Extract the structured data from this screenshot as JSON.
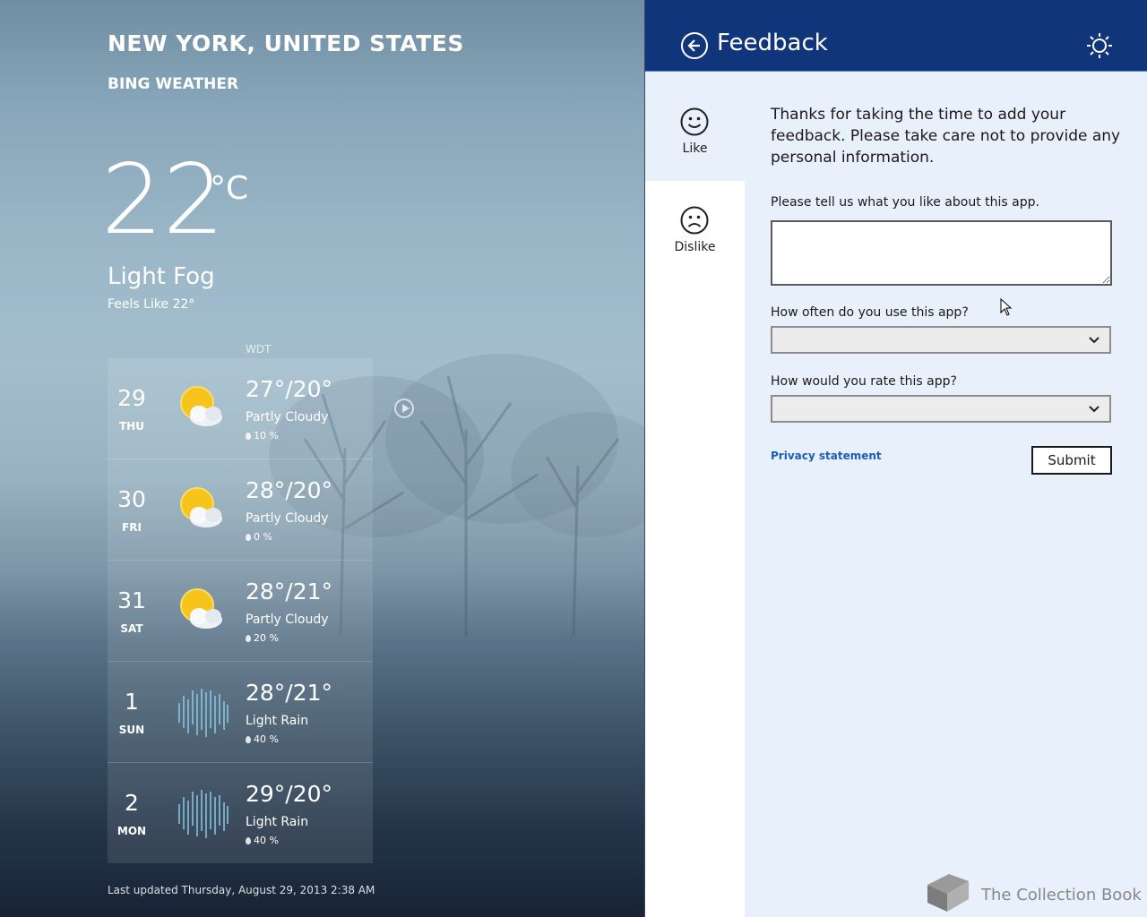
{
  "weather": {
    "location": "NEW YORK, UNITED STATES",
    "provider": "BING WEATHER",
    "temperature": "22",
    "unit": "°C",
    "condition": "Light Fog",
    "feels_like": "Feels Like 22°",
    "timezone": "WDT",
    "forecast": [
      {
        "day": "29",
        "weekday": "THU",
        "temps": "27°/20°",
        "condition": "Partly Cloudy",
        "precip": "10 %",
        "icon": "partly-cloudy-icon"
      },
      {
        "day": "30",
        "weekday": "FRI",
        "temps": "28°/20°",
        "condition": "Partly Cloudy",
        "precip": "0 %",
        "icon": "partly-cloudy-icon"
      },
      {
        "day": "31",
        "weekday": "SAT",
        "temps": "28°/21°",
        "condition": "Partly Cloudy",
        "precip": "20 %",
        "icon": "partly-cloudy-icon"
      },
      {
        "day": "1",
        "weekday": "SUN",
        "temps": "28°/21°",
        "condition": "Light Rain",
        "precip": "40 %",
        "icon": "light-rain-icon"
      },
      {
        "day": "2",
        "weekday": "MON",
        "temps": "29°/20°",
        "condition": "Light Rain",
        "precip": "40 %",
        "icon": "light-rain-icon"
      }
    ],
    "last_updated": "Last updated Thursday, August 29, 2013 2:38 AM"
  },
  "feedback": {
    "title": "Feedback",
    "tabs": [
      {
        "label": "Like",
        "icon": "smiley-icon",
        "selected": true
      },
      {
        "label": "Dislike",
        "icon": "frown-icon",
        "selected": false
      }
    ],
    "intro": "Thanks for taking the time to add your feedback. Please take care not to provide any personal information.",
    "question_like": "Please tell us what you like about this app.",
    "question_frequency": "How often do you use this app?",
    "frequency_value": "",
    "question_rating": "How would you rate this app?",
    "rating_value": "",
    "privacy_link": "Privacy statement",
    "submit_label": "Submit"
  },
  "watermark": "The Collection Book",
  "colors": {
    "header_blue": "#11357a",
    "panel_bg": "#e8f0fc",
    "link_blue": "#1a5fb4"
  }
}
